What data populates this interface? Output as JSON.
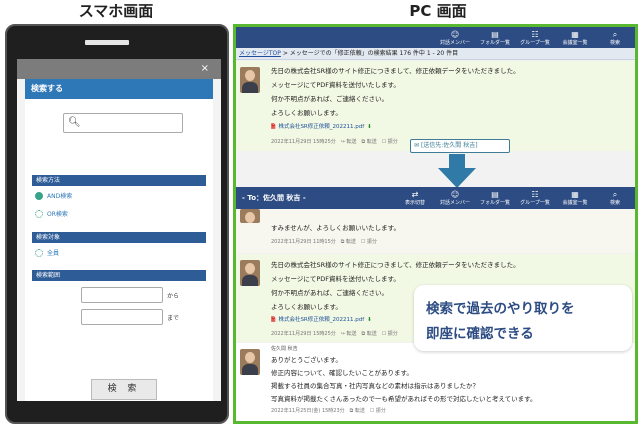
{
  "headings": {
    "sp": "スマホ画面",
    "pc": "PC 画面"
  },
  "sp": {
    "modal_title": "検索する",
    "close": "×",
    "sections": {
      "method": "検索方法",
      "target": "検索対象",
      "range": "検索範囲"
    },
    "options": {
      "and": "AND検索",
      "or": "OR検索",
      "all": "全員"
    },
    "from": "から",
    "to": "まで",
    "search_button": "検 索"
  },
  "pc": {
    "toolbar_top": [
      {
        "icon": "contact-icon",
        "label": "対話メンバー"
      },
      {
        "icon": "folder-icon",
        "label": "フォルダ一覧"
      },
      {
        "icon": "group-icon",
        "label": "グループ一覧"
      },
      {
        "icon": "room-icon",
        "label": "会議室一覧"
      },
      {
        "icon": "search-icon",
        "label": "検索"
      }
    ],
    "toolbar_bottom": [
      {
        "icon": "switch-icon",
        "label": "表示切替"
      },
      {
        "icon": "contact-icon",
        "label": "対話メンバー"
      },
      {
        "icon": "folder-icon",
        "label": "フォルダ一覧"
      },
      {
        "icon": "group-icon",
        "label": "グループ一覧"
      },
      {
        "icon": "room-icon",
        "label": "会議室一覧"
      },
      {
        "icon": "search-icon",
        "label": "検索"
      }
    ],
    "breadcrumb": {
      "top": "メッセージTOP",
      "sep": ">",
      "rest": "メッセージでの「修正依頼」の検索結果 176 件中 1 - 20 件目"
    },
    "msg1": {
      "lines": [
        "先日の株式会社SR様のサイト修正につきまして、修正依頼データをいただきました。",
        "メッセージにてPDF資料を送付いたします。",
        "何か不明点があれば、ご連絡ください。",
        "よろしくお願いします。"
      ],
      "attachment": "株式会社SR修正依頼_202211.pdf",
      "meta": "2022年11月29日 15時25分　↪ 転送　⧉ 転送　☐ 振分"
    },
    "destination": "[送信先:佐久間 秋吉]",
    "to_label": "- To：佐久間 秋吉 -",
    "msg2": {
      "line": "すみませんが、よろしくお願いいたします。",
      "meta": "2022年11月29日 11時15分　⧉ 転送　☐ 振分"
    },
    "msg3": {
      "lines": [
        "先日の株式会社SR様のサイト修正につきまして、修正依頼データをいただきました。",
        "メッセージにてPDF資料を送付いたします。",
        "何か不明点があれば、ご連絡ください。",
        "よろしくお願いします。"
      ],
      "attachment": "株式会社SR修正依頼_202211.pdf",
      "meta": "2022年11月29日 15時25分　↪ 転送　⧉ 転送　☐ 振分"
    },
    "msg4": {
      "name": "佐久間 秋吉",
      "lines": [
        "ありがとうございます。",
        "修正内容について、確認したいことがあります。",
        "掲載する社員の集合写真・社内写真などの素材は指示はありましたか？",
        "写真資料が掲載たくさんあったので一も希望があればその形で対応したいと考えています。"
      ],
      "meta": "2022年11月25日(金) 15時23分　⧉ 転送　☐ 振分"
    },
    "callout": [
      "検索で過去のやり取りを",
      "即座に確認できる"
    ]
  }
}
